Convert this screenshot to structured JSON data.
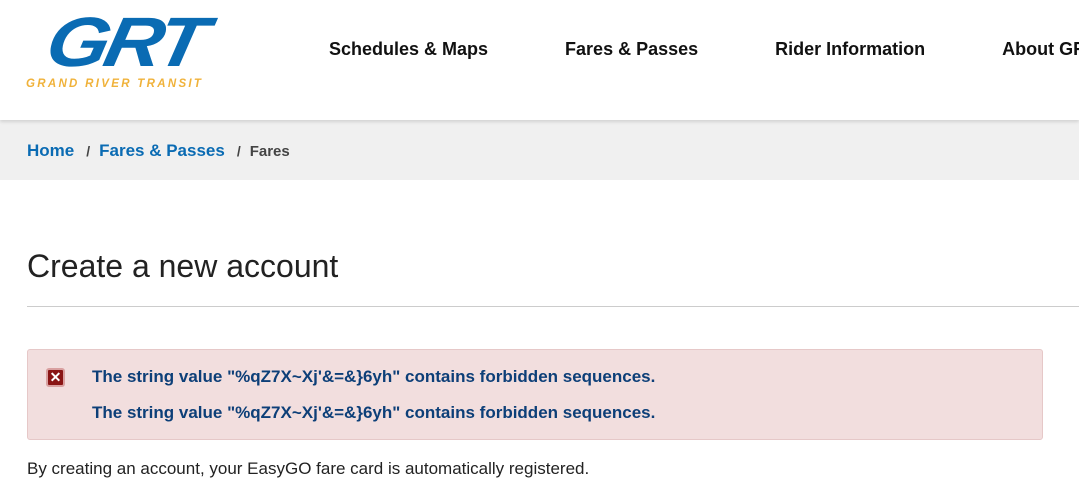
{
  "logo": {
    "main": "GRT",
    "sub": "GRAND RIVER TRANSIT"
  },
  "nav": [
    "Schedules & Maps",
    "Fares & Passes",
    "Rider Information",
    "About GRT"
  ],
  "breadcrumb": {
    "home": "Home",
    "parent": "Fares & Passes",
    "current": "Fares",
    "separator": "/"
  },
  "page": {
    "title": "Create a new account",
    "intro": "By creating an account, your EasyGO fare card is automatically registered."
  },
  "errors": {
    "icon": "error-x-icon",
    "messages": [
      "The string value \"%qZ7X~Xj'&=&}6yh\" contains forbidden sequences.",
      "The string value \"%qZ7X~Xj'&=&}6yh\" contains forbidden sequences."
    ]
  },
  "colors": {
    "brand": "#0a6bb3",
    "accent": "#f0b23a",
    "error_bg": "#f2dede",
    "error_text": "#0d3f78"
  }
}
